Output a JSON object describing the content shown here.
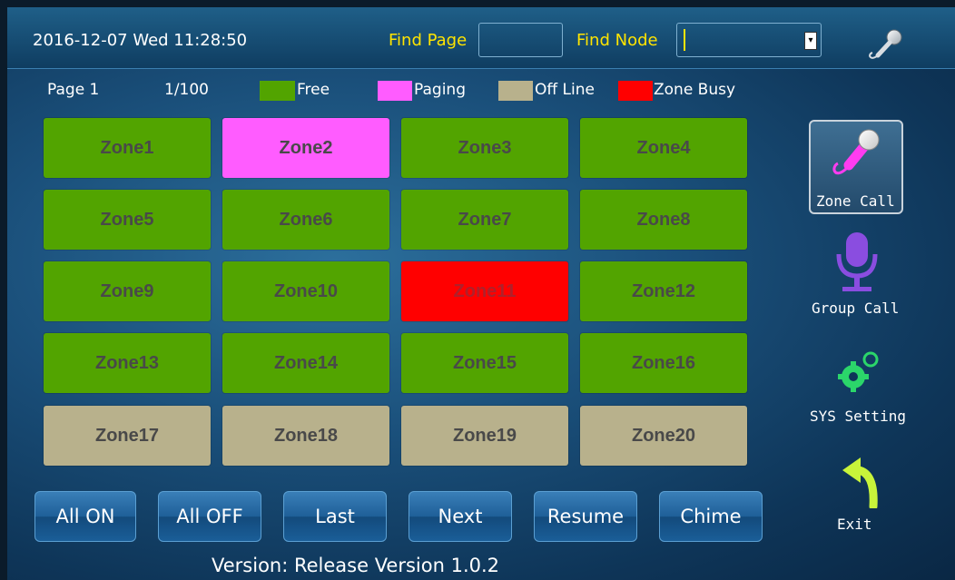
{
  "header": {
    "datetime": "2016-12-07  Wed  11:28:50",
    "find_page_label": "Find Page",
    "find_page_value": "",
    "find_node_label": "Find Node",
    "find_node_value": ""
  },
  "legend": {
    "page_label": "Page  1",
    "page_count": "1/100",
    "items": [
      {
        "label": "Free",
        "color": "#52a400"
      },
      {
        "label": "Paging",
        "color": "#ff5cff"
      },
      {
        "label": "Off Line",
        "color": "#b8b18c"
      },
      {
        "label": "Zone Busy",
        "color": "#ff0000"
      }
    ]
  },
  "zones": [
    {
      "label": "Zone1",
      "status": "Free"
    },
    {
      "label": "Zone2",
      "status": "Paging"
    },
    {
      "label": "Zone3",
      "status": "Free"
    },
    {
      "label": "Zone4",
      "status": "Free"
    },
    {
      "label": "Zone5",
      "status": "Free"
    },
    {
      "label": "Zone6",
      "status": "Free"
    },
    {
      "label": "Zone7",
      "status": "Free"
    },
    {
      "label": "Zone8",
      "status": "Free"
    },
    {
      "label": "Zone9",
      "status": "Free"
    },
    {
      "label": "Zone10",
      "status": "Free"
    },
    {
      "label": "Zone11",
      "status": "Zone Busy"
    },
    {
      "label": "Zone12",
      "status": "Free"
    },
    {
      "label": "Zone13",
      "status": "Free"
    },
    {
      "label": "Zone14",
      "status": "Free"
    },
    {
      "label": "Zone15",
      "status": "Free"
    },
    {
      "label": "Zone16",
      "status": "Free"
    },
    {
      "label": "Zone17",
      "status": "Off Line"
    },
    {
      "label": "Zone18",
      "status": "Off Line"
    },
    {
      "label": "Zone19",
      "status": "Off Line"
    },
    {
      "label": "Zone20",
      "status": "Off Line"
    }
  ],
  "sidebar": {
    "zone_call": {
      "label": "Zone Call",
      "icon": "microphone-icon"
    },
    "group_call": {
      "label": "Group Call",
      "icon": "desk-microphone-icon"
    },
    "sys_setting": {
      "label": "SYS Setting",
      "icon": "gears-icon"
    },
    "exit": {
      "label": "Exit",
      "icon": "back-arrow-icon"
    }
  },
  "buttons": {
    "all_on": "All ON",
    "all_off": "All OFF",
    "last": "Last",
    "next": "Next",
    "resume": "Resume",
    "chime": "Chime"
  },
  "version": "Version:  Release Version 1.0.2"
}
